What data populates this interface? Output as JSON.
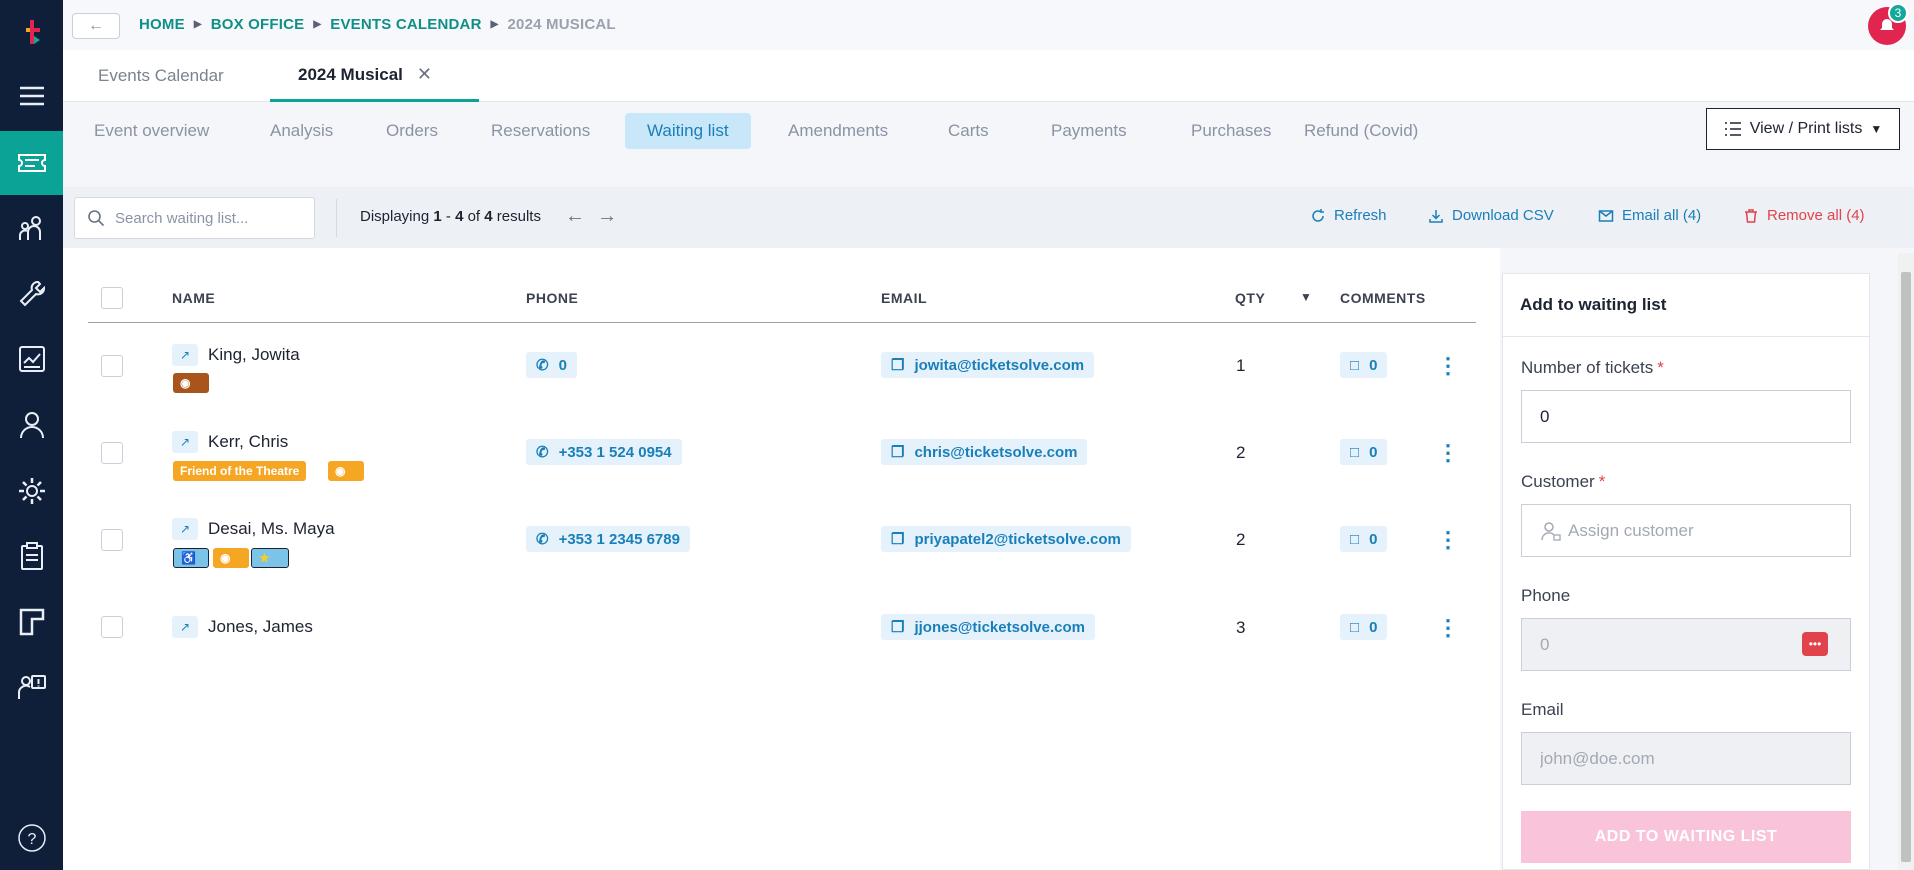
{
  "breadcrumb": {
    "home": "HOME",
    "box_office": "BOX OFFICE",
    "events_calendar": "EVENTS CALENDAR",
    "current": "2024 MUSICAL"
  },
  "notifications": {
    "count": "3"
  },
  "doc_tabs": {
    "tab1": "Events Calendar",
    "tab2": "2024 Musical"
  },
  "subnav": {
    "event_overview": "Event overview",
    "analysis": "Analysis",
    "orders": "Orders",
    "reservations": "Reservations",
    "waiting_list": "Waiting list",
    "amendments": "Amendments",
    "carts": "Carts",
    "payments": "Payments",
    "purchases": "Purchases",
    "refund": "Refund (Covid)",
    "view_print": "View / Print lists"
  },
  "toolbar": {
    "search_placeholder": "Search waiting list...",
    "displaying_prefix": "Displaying ",
    "range_start": "1",
    "range_sep": " - ",
    "range_end": "4",
    "of": " of ",
    "total": "4",
    "results": " results",
    "refresh": "Refresh",
    "download_csv": "Download CSV",
    "email_all": "Email all (4)",
    "remove_all": "Remove all (4)"
  },
  "table": {
    "headers": {
      "name": "NAME",
      "phone": "PHONE",
      "email": "EMAIL",
      "qty": "QTY",
      "comments": "COMMENTS"
    },
    "rows": [
      {
        "name": "King, Jowita",
        "phone": "0",
        "email": "jowita@ticketsolve.com",
        "qty": "1",
        "comments": "0"
      },
      {
        "name": "Kerr, Chris",
        "phone": "+353 1 524 0954",
        "email": "chris@ticketsolve.com",
        "qty": "2",
        "comments": "0",
        "tag": "Friend of the Theatre"
      },
      {
        "name": "Desai, Ms. Maya",
        "phone": "+353 1 2345 6789",
        "email": "priyapatel2@ticketsolve.com",
        "qty": "2",
        "comments": "0"
      },
      {
        "name": "Jones, James",
        "phone": "",
        "email": "jjones@ticketsolve.com",
        "qty": "3",
        "comments": "0"
      }
    ]
  },
  "panel": {
    "title": "Add to waiting list",
    "tickets_label": "Number of tickets",
    "tickets_value": "0",
    "customer_label": "Customer",
    "customer_placeholder": "Assign customer",
    "phone_label": "Phone",
    "phone_value": "0",
    "email_label": "Email",
    "email_placeholder": "john@doe.com",
    "required_mark": "*",
    "submit": "ADD TO WAITING LIST"
  },
  "colors": {
    "sidebar": "#0f1f3a",
    "accent_teal": "#0aa396",
    "link_blue": "#1a7fb9",
    "danger_red": "#e0434b",
    "submit_disabled_pink": "#f9c4da"
  },
  "icons": [
    "logo-icon",
    "menu-icon",
    "ticket-icon",
    "people-icon",
    "wrench-icon",
    "report-icon",
    "user-icon",
    "gear-icon",
    "clipboard-icon",
    "layout-icon",
    "support-icon",
    "help-icon"
  ]
}
